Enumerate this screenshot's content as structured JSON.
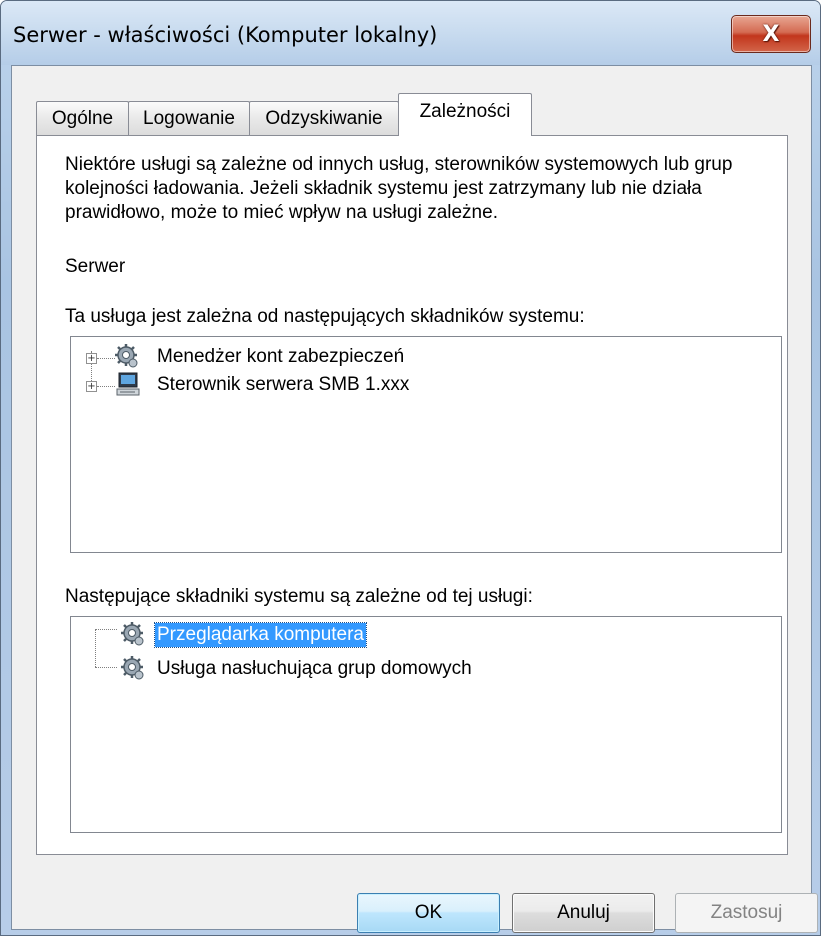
{
  "window": {
    "title": "Serwer - właściwości (Komputer lokalny)",
    "close_label": "X"
  },
  "tabs": [
    {
      "label": "Ogólne",
      "active": false
    },
    {
      "label": "Logowanie",
      "active": false
    },
    {
      "label": "Odzyskiwanie",
      "active": false
    },
    {
      "label": "Zależności",
      "active": true
    }
  ],
  "panel": {
    "intro_text": "Niektóre usługi są zależne od innych usług, sterowników systemowych lub grup kolejności ładowania. Jeżeli składnik systemu jest zatrzymany lub nie działa prawidłowo, może to mieć wpływ na usługi zależne.",
    "service_name": "Serwer",
    "depends_on_label": "Ta usługa jest zależna od następujących składników systemu:",
    "depends_on_items": [
      {
        "label": "Menedżer kont zabezpieczeń",
        "icon": "gear-icon",
        "expandable": true
      },
      {
        "label": "Sterownik serwera SMB 1.xxx",
        "icon": "computer-icon",
        "expandable": true
      }
    ],
    "dependents_label": "Następujące składniki systemu są zależne od tej usługi:",
    "dependents_items": [
      {
        "label": "Przeglądarka komputera",
        "icon": "gear-icon",
        "selected": true
      },
      {
        "label": "Usługa nasłuchująca grup domowych",
        "icon": "gear-icon",
        "selected": false
      }
    ]
  },
  "buttons": {
    "ok": "OK",
    "cancel": "Anuluj",
    "apply": "Zastosuj",
    "apply_enabled": false
  },
  "colors": {
    "selection": "#3399ff",
    "close_button": "#c2361c",
    "title_bar": "#c8dbef"
  }
}
